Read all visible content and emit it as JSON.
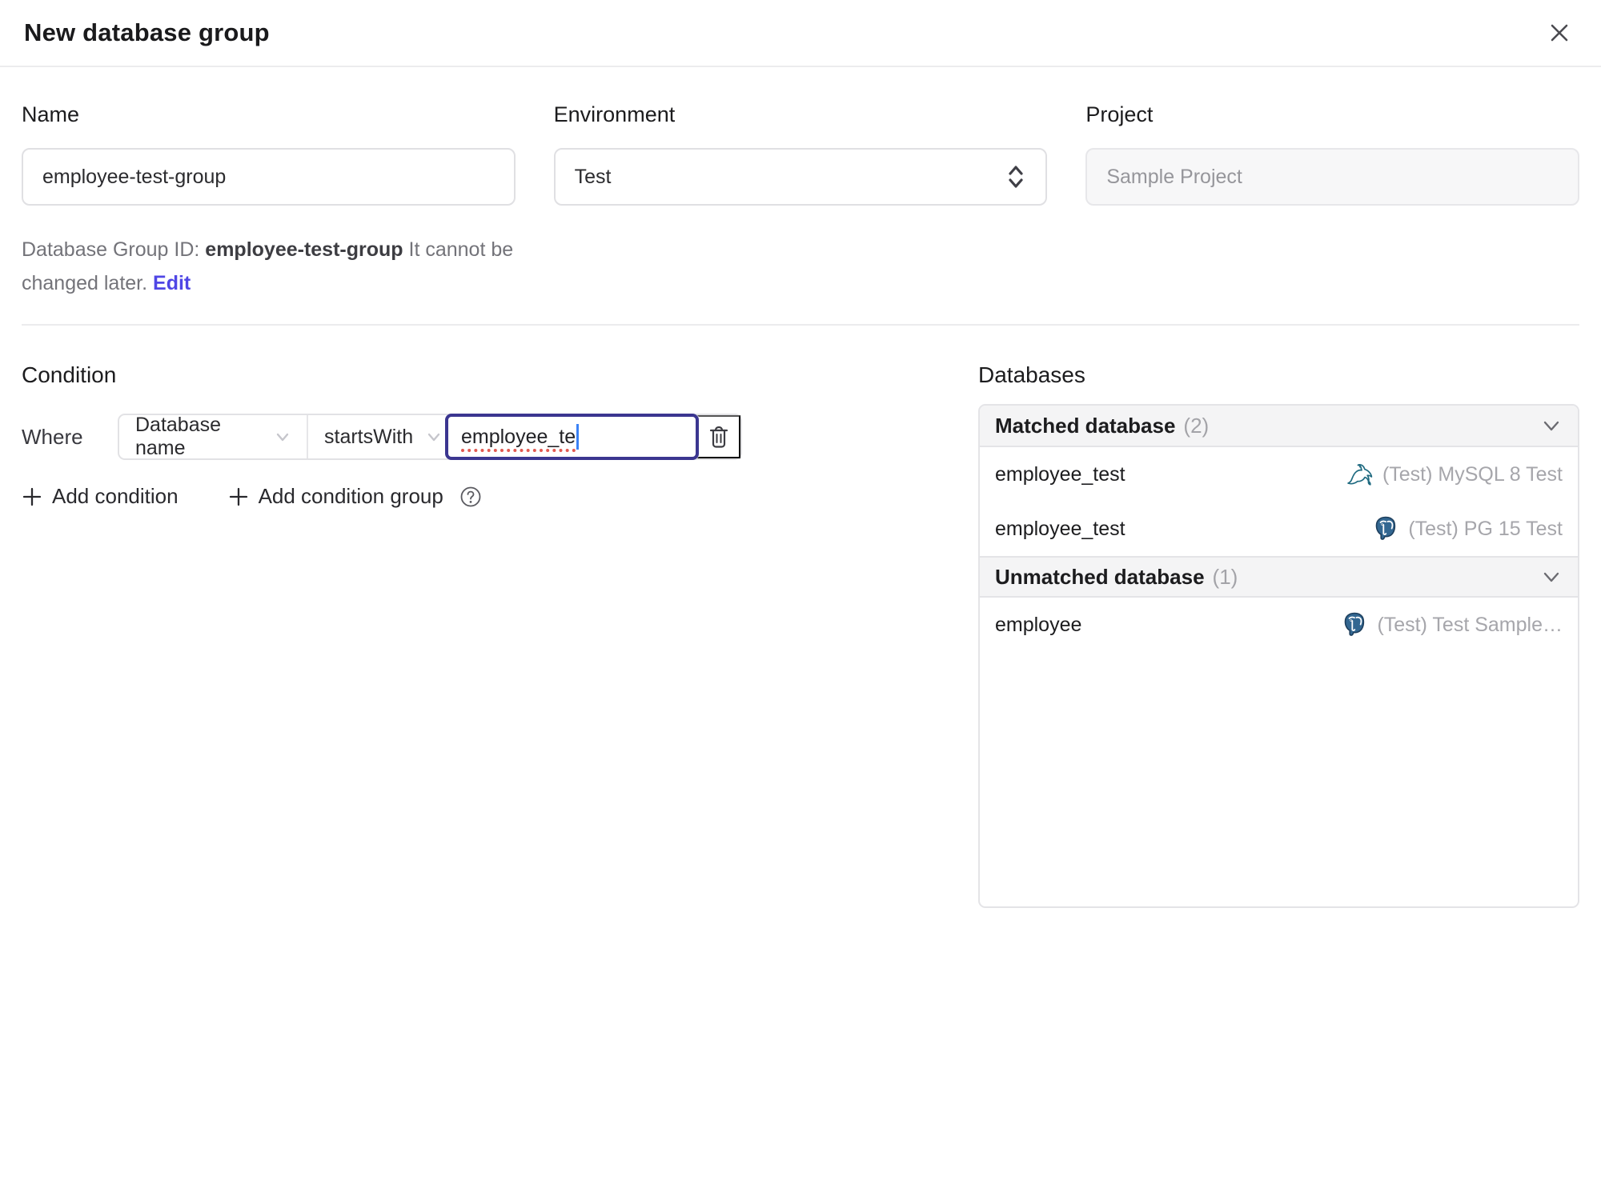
{
  "dialog": {
    "title": "New database group"
  },
  "form": {
    "name": {
      "label": "Name",
      "value": "employee-test-group"
    },
    "environment": {
      "label": "Environment",
      "value": "Test"
    },
    "project": {
      "label": "Project",
      "value": "Sample Project"
    },
    "group_id_note": {
      "prefix": "Database Group ID: ",
      "id": "employee-test-group",
      "suffix": " It cannot be changed later. ",
      "edit_label": "Edit"
    }
  },
  "condition": {
    "heading": "Condition",
    "where_label": "Where",
    "field_selected": "Database name",
    "operator_selected": "startsWith",
    "value": "employee_te",
    "add_condition_label": "Add condition",
    "add_condition_group_label": "Add condition group"
  },
  "databases": {
    "heading": "Databases",
    "sections": [
      {
        "title": "Matched database",
        "count": "(2)",
        "rows": [
          {
            "name": "employee_test",
            "engine": "mysql",
            "instance": "(Test) MySQL 8 Test"
          },
          {
            "name": "employee_test",
            "engine": "postgres",
            "instance": "(Test) PG 15 Test"
          }
        ]
      },
      {
        "title": "Unmatched database",
        "count": "(1)",
        "rows": [
          {
            "name": "employee",
            "engine": "postgres",
            "instance": "(Test) Test Sample…"
          }
        ]
      }
    ]
  },
  "icons": {
    "close": "x-cross",
    "environment_select": "chevron-up-down",
    "condition_select": "chevron-down",
    "delete": "trash-can",
    "help": "question-mark-circle",
    "add": "plus",
    "section_collapse": "chevron-down",
    "mysql": "dolphin-logo",
    "postgres": "elephant-logo"
  },
  "colors": {
    "accent_link": "#4f46e5",
    "focused_input_border": "#3b3690",
    "text_caret": "#3b82f6",
    "spellcheck_underline": "#e25a52",
    "section_header_bg": "#f4f4f5",
    "border": "#e4e4e7",
    "muted_text": "#a6a6ab",
    "mysql_teal": "#1f6a80",
    "postgres_blue": "#336791"
  }
}
